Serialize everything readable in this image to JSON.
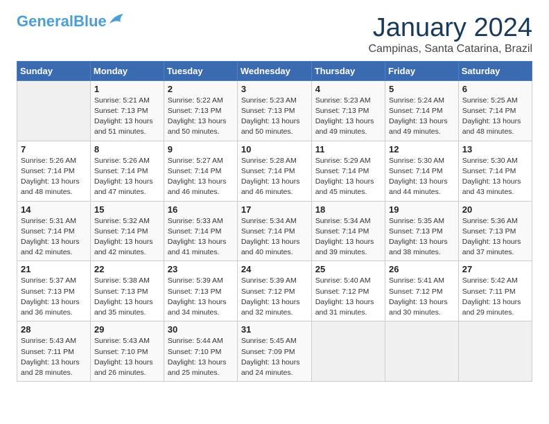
{
  "header": {
    "logo_general": "General",
    "logo_blue": "Blue",
    "month": "January 2024",
    "location": "Campinas, Santa Catarina, Brazil"
  },
  "weekdays": [
    "Sunday",
    "Monday",
    "Tuesday",
    "Wednesday",
    "Thursday",
    "Friday",
    "Saturday"
  ],
  "weeks": [
    [
      {
        "day": "",
        "info": ""
      },
      {
        "day": "1",
        "info": "Sunrise: 5:21 AM\nSunset: 7:13 PM\nDaylight: 13 hours\nand 51 minutes."
      },
      {
        "day": "2",
        "info": "Sunrise: 5:22 AM\nSunset: 7:13 PM\nDaylight: 13 hours\nand 50 minutes."
      },
      {
        "day": "3",
        "info": "Sunrise: 5:23 AM\nSunset: 7:13 PM\nDaylight: 13 hours\nand 50 minutes."
      },
      {
        "day": "4",
        "info": "Sunrise: 5:23 AM\nSunset: 7:13 PM\nDaylight: 13 hours\nand 49 minutes."
      },
      {
        "day": "5",
        "info": "Sunrise: 5:24 AM\nSunset: 7:14 PM\nDaylight: 13 hours\nand 49 minutes."
      },
      {
        "day": "6",
        "info": "Sunrise: 5:25 AM\nSunset: 7:14 PM\nDaylight: 13 hours\nand 48 minutes."
      }
    ],
    [
      {
        "day": "7",
        "info": "Sunrise: 5:26 AM\nSunset: 7:14 PM\nDaylight: 13 hours\nand 48 minutes."
      },
      {
        "day": "8",
        "info": "Sunrise: 5:26 AM\nSunset: 7:14 PM\nDaylight: 13 hours\nand 47 minutes."
      },
      {
        "day": "9",
        "info": "Sunrise: 5:27 AM\nSunset: 7:14 PM\nDaylight: 13 hours\nand 46 minutes."
      },
      {
        "day": "10",
        "info": "Sunrise: 5:28 AM\nSunset: 7:14 PM\nDaylight: 13 hours\nand 46 minutes."
      },
      {
        "day": "11",
        "info": "Sunrise: 5:29 AM\nSunset: 7:14 PM\nDaylight: 13 hours\nand 45 minutes."
      },
      {
        "day": "12",
        "info": "Sunrise: 5:30 AM\nSunset: 7:14 PM\nDaylight: 13 hours\nand 44 minutes."
      },
      {
        "day": "13",
        "info": "Sunrise: 5:30 AM\nSunset: 7:14 PM\nDaylight: 13 hours\nand 43 minutes."
      }
    ],
    [
      {
        "day": "14",
        "info": "Sunrise: 5:31 AM\nSunset: 7:14 PM\nDaylight: 13 hours\nand 42 minutes."
      },
      {
        "day": "15",
        "info": "Sunrise: 5:32 AM\nSunset: 7:14 PM\nDaylight: 13 hours\nand 42 minutes."
      },
      {
        "day": "16",
        "info": "Sunrise: 5:33 AM\nSunset: 7:14 PM\nDaylight: 13 hours\nand 41 minutes."
      },
      {
        "day": "17",
        "info": "Sunrise: 5:34 AM\nSunset: 7:14 PM\nDaylight: 13 hours\nand 40 minutes."
      },
      {
        "day": "18",
        "info": "Sunrise: 5:34 AM\nSunset: 7:14 PM\nDaylight: 13 hours\nand 39 minutes."
      },
      {
        "day": "19",
        "info": "Sunrise: 5:35 AM\nSunset: 7:13 PM\nDaylight: 13 hours\nand 38 minutes."
      },
      {
        "day": "20",
        "info": "Sunrise: 5:36 AM\nSunset: 7:13 PM\nDaylight: 13 hours\nand 37 minutes."
      }
    ],
    [
      {
        "day": "21",
        "info": "Sunrise: 5:37 AM\nSunset: 7:13 PM\nDaylight: 13 hours\nand 36 minutes."
      },
      {
        "day": "22",
        "info": "Sunrise: 5:38 AM\nSunset: 7:13 PM\nDaylight: 13 hours\nand 35 minutes."
      },
      {
        "day": "23",
        "info": "Sunrise: 5:39 AM\nSunset: 7:13 PM\nDaylight: 13 hours\nand 34 minutes."
      },
      {
        "day": "24",
        "info": "Sunrise: 5:39 AM\nSunset: 7:12 PM\nDaylight: 13 hours\nand 32 minutes."
      },
      {
        "day": "25",
        "info": "Sunrise: 5:40 AM\nSunset: 7:12 PM\nDaylight: 13 hours\nand 31 minutes."
      },
      {
        "day": "26",
        "info": "Sunrise: 5:41 AM\nSunset: 7:12 PM\nDaylight: 13 hours\nand 30 minutes."
      },
      {
        "day": "27",
        "info": "Sunrise: 5:42 AM\nSunset: 7:11 PM\nDaylight: 13 hours\nand 29 minutes."
      }
    ],
    [
      {
        "day": "28",
        "info": "Sunrise: 5:43 AM\nSunset: 7:11 PM\nDaylight: 13 hours\nand 28 minutes."
      },
      {
        "day": "29",
        "info": "Sunrise: 5:43 AM\nSunset: 7:10 PM\nDaylight: 13 hours\nand 26 minutes."
      },
      {
        "day": "30",
        "info": "Sunrise: 5:44 AM\nSunset: 7:10 PM\nDaylight: 13 hours\nand 25 minutes."
      },
      {
        "day": "31",
        "info": "Sunrise: 5:45 AM\nSunset: 7:09 PM\nDaylight: 13 hours\nand 24 minutes."
      },
      {
        "day": "",
        "info": ""
      },
      {
        "day": "",
        "info": ""
      },
      {
        "day": "",
        "info": ""
      }
    ]
  ]
}
